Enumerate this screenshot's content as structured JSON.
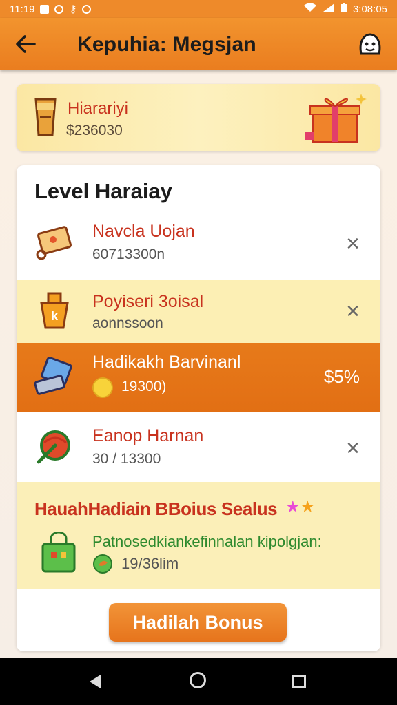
{
  "status_bar": {
    "time_left": "11:19",
    "time_right": "3:08:05"
  },
  "app_bar": {
    "title": "Kepuhia: Megsjan"
  },
  "balance_card": {
    "title": "Hiarariyi",
    "value": "$236030"
  },
  "level_section": {
    "heading": "Level Haraiay",
    "rows": [
      {
        "title": "Navcla Uojan",
        "subtitle": "60713300n",
        "icon": "book-keychain-icon"
      },
      {
        "title": "Poyiseri 3oisal",
        "subtitle": "aonnssoon",
        "icon": "k-bucket-icon"
      },
      {
        "title": "Hadikakh Barvinanl",
        "subtitle": "19300)",
        "icon": "tablet-icon",
        "percent": "$5%"
      },
      {
        "title": "Eanop Harnan",
        "subtitle": "30 / 13300",
        "icon": "leaf-pot-icon"
      }
    ]
  },
  "bonus_section": {
    "title": "HauahHadiain BBoius Sealus",
    "description": "Patnosedkiankefinnalan kipolgjan:",
    "progress": "19/36lim"
  },
  "button": {
    "label": "Hadilah Bonus"
  },
  "colors": {
    "primary": "#ea7d1f",
    "accent": "#c8321e",
    "highlight": "#fcefb4"
  }
}
